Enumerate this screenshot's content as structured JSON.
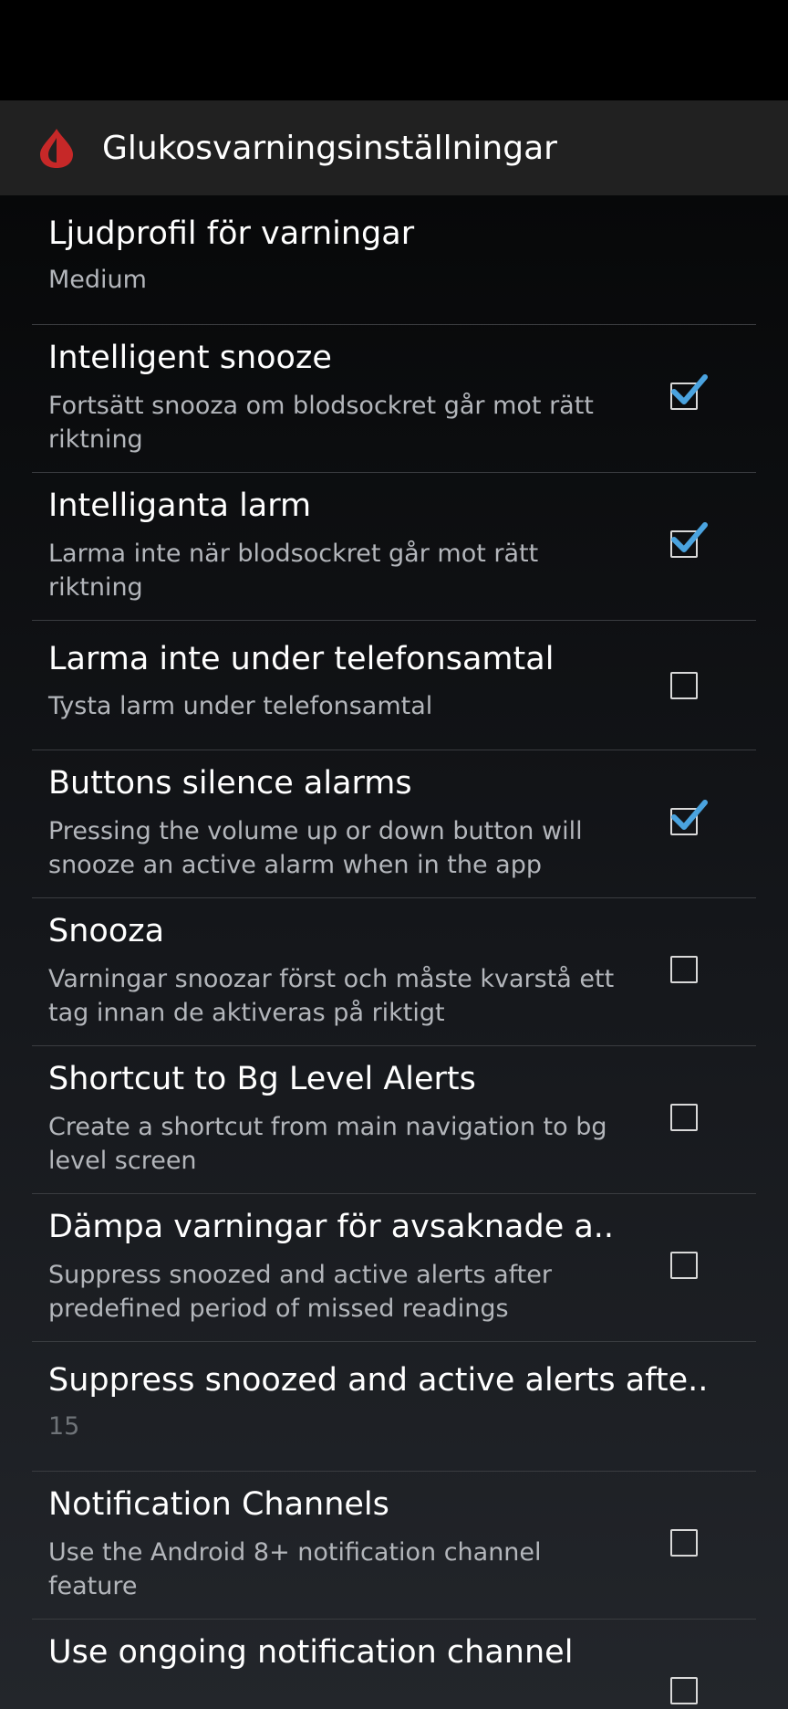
{
  "app_bar": {
    "title": "Glukosvarningsinställningar",
    "icon": "blood-drop-icon"
  },
  "colors": {
    "accent": "#4aa3df",
    "icon_red": "#c62828",
    "app_bar_bg": "#212121"
  },
  "preferences": [
    {
      "title": "Ljudprofil för varningar",
      "summary": "Medium"
    },
    {
      "title": "Intelligent snooze",
      "summary": "Fortsätt snooza om blodsockret går mot rätt riktning",
      "checked": true
    },
    {
      "title": "Intelliganta larm",
      "summary": "Larma inte när blodsockret går mot rätt riktning",
      "checked": true
    },
    {
      "title": "Larma inte under telefonsamtal",
      "summary": "Tysta larm under telefonsamtal",
      "checked": false
    },
    {
      "title": "Buttons silence alarms",
      "summary": "Pressing the volume up or down button will snooze an active alarm when in the app",
      "checked": true
    },
    {
      "title": "Snooza",
      "summary": "Varningar snoozar först och måste kvarstå ett tag innan de aktiveras på riktigt",
      "checked": false
    },
    {
      "title": "Shortcut to Bg Level Alerts",
      "summary": "Create a shortcut from main navigation to bg level screen",
      "checked": false
    },
    {
      "title": "Dämpa varningar för avsaknade a..",
      "summary": "Suppress snoozed and active alerts after predefined period of missed readings",
      "checked": false
    },
    {
      "title": "Suppress snoozed and active alerts afte..",
      "summary": "15"
    },
    {
      "title": "Notification Channels",
      "summary": "Use the Android 8+ notification channel feature",
      "checked": false
    },
    {
      "title": "Use ongoing notification channel"
    }
  ]
}
